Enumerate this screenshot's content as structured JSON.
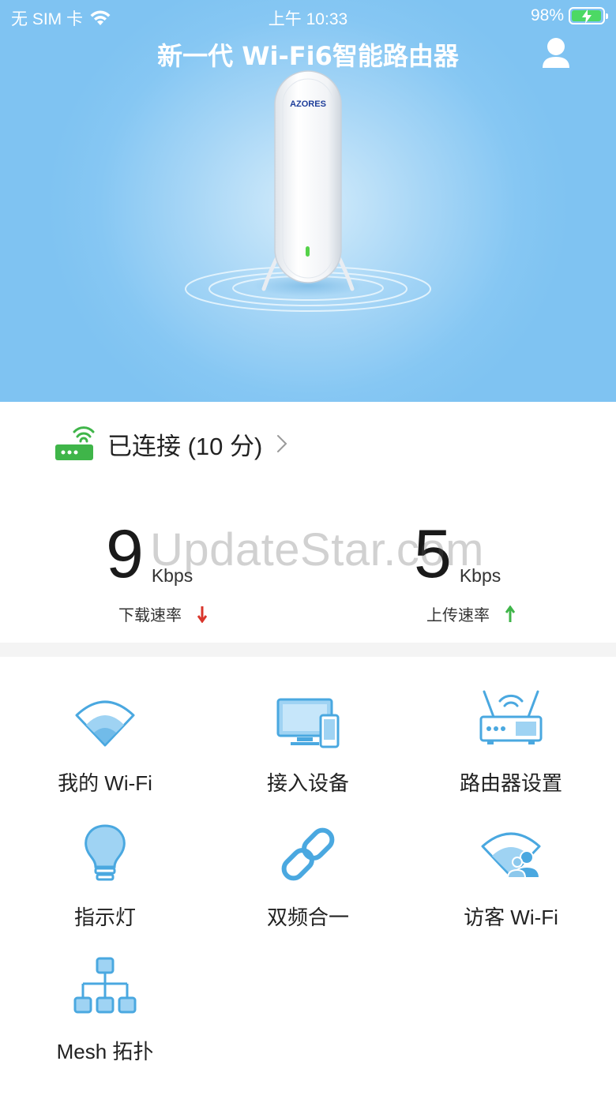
{
  "status_bar": {
    "carrier": "无 SIM 卡",
    "time": "上午 10:33",
    "battery": "98%",
    "battery_level": 0.98
  },
  "header": {
    "title": "新一代 Wi-Fi6智能路由器",
    "router_brand": "AZORES"
  },
  "connection": {
    "status": "已连接 (10 分)"
  },
  "speeds": {
    "download": {
      "value": "9",
      "unit": "Kbps",
      "label": "下载速率"
    },
    "upload": {
      "value": "5",
      "unit": "Kbps",
      "label": "上传速率"
    }
  },
  "watermark": "UpdateStar.com",
  "menu": {
    "my_wifi": "我的 Wi-Fi",
    "devices": "接入设备",
    "router_settings": "路由器设置",
    "indicator_light": "指示灯",
    "dual_band": "双频合一",
    "guest_wifi": "访客 Wi-Fi",
    "mesh": "Mesh 拓扑"
  },
  "colors": {
    "accent_blue": "#4aa8e0",
    "header_blue": "#86c7f3",
    "connected_green": "#3fb549",
    "download_red": "#d9352b",
    "upload_green": "#3fb549"
  }
}
